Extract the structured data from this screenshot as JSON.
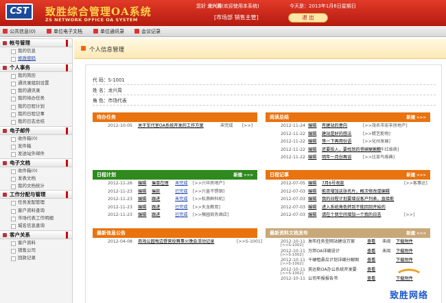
{
  "header": {
    "logo": "CST",
    "system_name": "致胜综合管理OA系统",
    "system_sub": "ZS NETWORK OFFICE OA SYSTEM",
    "welcome_prefix": "您好",
    "user_name": "龙兴周",
    "welcome_suffix": "(欢迎使用本系统)",
    "today": "今天是：2013年1月6日星期日",
    "dept": "[市场部 销售主管]",
    "exit_label": "退 出"
  },
  "nav": [
    "公共信息(0)",
    "单位电子文档",
    "单位通讯录",
    "会议记录"
  ],
  "sidebar": [
    {
      "title": "帐号管理",
      "items": [
        "我的信息",
        "修改密码"
      ],
      "active": 1
    },
    {
      "title": "个人事务",
      "items": [
        "我的简历",
        "通讯录组别设置",
        "我的通讯录",
        "我的待办任务",
        "我的日程计划",
        "我的日程记事",
        "我的日志总结"
      ]
    },
    {
      "title": "电子邮件",
      "items": [
        "收件箱(0)",
        "发件箱",
        "发送站外邮件"
      ]
    },
    {
      "title": "电子文档",
      "items": [
        "收件箱(0)",
        "发表文档",
        "我的文档统计"
      ]
    },
    {
      "title": "工作分配与管理",
      "items": [
        "任务发配管理",
        "客户资料查询",
        "市场代表工作明细",
        "城名信息查询"
      ]
    },
    {
      "title": "客户关系",
      "items": [
        "客户资料",
        "销售公司",
        "回款记录"
      ]
    }
  ],
  "page_title": "个人信息管理",
  "info": {
    "code": "代 码：S-1001",
    "name": "姓 名：龙兴周",
    "role": "角 色：市场代表"
  },
  "panels": {
    "tasks": {
      "title": "待办任务",
      "rows": [
        {
          "date": "2012-10-05",
          "title": "关于军代室OA系统开发的工作方案",
          "status": "未完成",
          "tag": "[>>]"
        }
      ]
    },
    "logs": {
      "title": "阅读总结",
      "more": "新建",
      "rows": [
        {
          "date": "2012-11-24",
          "op": "编辑",
          "title": "有建站的意向",
          "tag": "[>>茂名市宏丰房地产]"
        },
        {
          "date": "2012-11-22",
          "op": "编辑",
          "title": "建站是好的想法",
          "tag": "[>>精艺能物]"
        },
        {
          "date": "2012-11-22",
          "op": "编辑",
          "title": "等一下再用份语",
          "tag": "[>>化州发展]"
        },
        {
          "date": "2012-11-22",
          "op": "编辑",
          "title": "还要投入，要找到的手续联系你",
          "tag": "[>>万荣千红维质]"
        },
        {
          "date": "2012-11-22",
          "op": "编辑",
          "title": "明年一月份再谈",
          "tag": "[>>比亚鸟维典]"
        }
      ]
    },
    "plans": {
      "title": "日程计划",
      "more": "新建",
      "rows": [
        {
          "date": "2012-11-26",
          "op": "编辑",
          "act": "催单在理",
          "status": "未完成",
          "tag": "[>>兴华房地产]"
        },
        {
          "date": "2012-11-23",
          "op": "编辑",
          "act": "催款",
          "status": "已完成",
          "tag": "[>>兴盖不锈钢]"
        },
        {
          "date": "2012-11-23",
          "op": "编辑",
          "act": "跟进",
          "status": "未完成",
          "tag": "[>>松燕鲜科机]"
        },
        {
          "date": "2012-11-23",
          "op": "编辑",
          "act": "跟进",
          "status": "已完成",
          "tag": "[>>天龙教育]"
        },
        {
          "date": "2012-11-23",
          "op": "编辑",
          "act": "跟进",
          "status": "已完成",
          "tag": "[>>豫园商务酒店]"
        }
      ]
    },
    "notes": {
      "title": "日程记事",
      "more": "新建",
      "rows": [
        {
          "date": "2012-07-05",
          "op": "编辑",
          "title": "7月6号收款",
          "tag": "[>>客事达]"
        },
        {
          "date": "2012-07-03",
          "op": "编辑",
          "title": "能否增加这张名片，概次修改或编辑"
        },
        {
          "date": "2012-07-03",
          "op": "编辑",
          "title": "我的日程计划要增设客户列表，直接能"
        },
        {
          "date": "2012-07-03",
          "op": "编辑",
          "title": "进入系统角色转到不能回到开始的"
        },
        {
          "date": "2012-07-03",
          "op": "编辑",
          "title": "请在个我空间增加一个我的日志",
          "tag": "[>>]"
        }
      ]
    },
    "news": {
      "title": "最新信息公告",
      "rows": [
        {
          "date": "2012-04-08",
          "title": "商海公园每边督营役舞事火晚会活动记录",
          "tag": "[>>S-1001]"
        }
      ]
    },
    "docs": {
      "title": "最新资料文档发布",
      "more": "新建",
      "rows": [
        {
          "date": "2012-10-11",
          "title": "发布任务型网站建设方案",
          "view": "查看",
          "status": "未阅",
          "dl": "下载附件",
          "tag": "[>>S-1002]"
        },
        {
          "date": "2012-10-11",
          "title": "万邦OA详细设计",
          "view": "查看",
          "status": "未阅",
          "dl": "下载附件",
          "tag": "[>>S-1002]"
        },
        {
          "date": "2012-10-11",
          "title": "千硬租悬瓜计划详细分解图",
          "view": "查看",
          "dl": "下载附件",
          "tag": "[>>S-1002]"
        },
        {
          "date": "2012-10-11",
          "title": "英达斯OA办公系统开发要",
          "view": "查看",
          "tag": "[>>S-1002]"
        },
        {
          "date": "2012-10-11",
          "title": "公司年报报告书",
          "view": "查看",
          "dl": "下载附件"
        }
      ]
    }
  },
  "watermark": "致胜网络",
  "colors": {
    "header_red": "#c8261a",
    "orange_head": "#e8730f",
    "green_head": "#2f8a1e",
    "tan_head": "#c9a878",
    "accent": "#1a3fa8"
  }
}
